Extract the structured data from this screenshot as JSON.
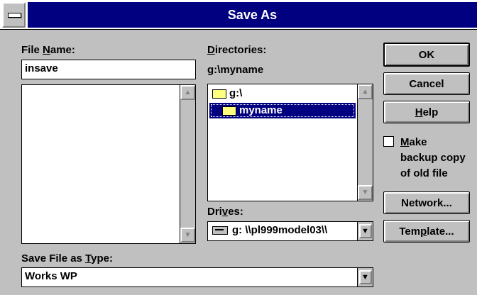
{
  "window": {
    "title": "Save As"
  },
  "file_name": {
    "label_pre": "File ",
    "label_acc": "N",
    "label_post": "ame:",
    "value": "insave",
    "list_items": []
  },
  "directories": {
    "label": "Directories:",
    "current_path": "g:\\myname",
    "items": [
      {
        "label": "g:\\",
        "icon": "open-folder-icon",
        "selected": false
      },
      {
        "label": "myname",
        "icon": "open-folder-icon",
        "selected": true
      }
    ]
  },
  "drives": {
    "label_pre": "Dri",
    "label_acc": "v",
    "label_post": "es:",
    "value": "g: \\\\pl999model03\\\\",
    "icon": "network-drive-icon"
  },
  "save_type": {
    "label_pre": "Save File as ",
    "label_acc": "T",
    "label_post": "ype:",
    "value": "Works WP"
  },
  "buttons": {
    "ok": "OK",
    "cancel": "Cancel",
    "help_acc": "H",
    "help_post": "elp",
    "network": "Network...",
    "template_pre": "Tem",
    "template_acc": "p",
    "template_post": "late..."
  },
  "backup": {
    "line1_acc": "M",
    "line1_post": "ake",
    "line2": "backup copy",
    "line3": "of old file",
    "checked": false
  },
  "colors": {
    "title_bar": "#000080",
    "face": "#c0c0c0",
    "selection": "#000080"
  }
}
